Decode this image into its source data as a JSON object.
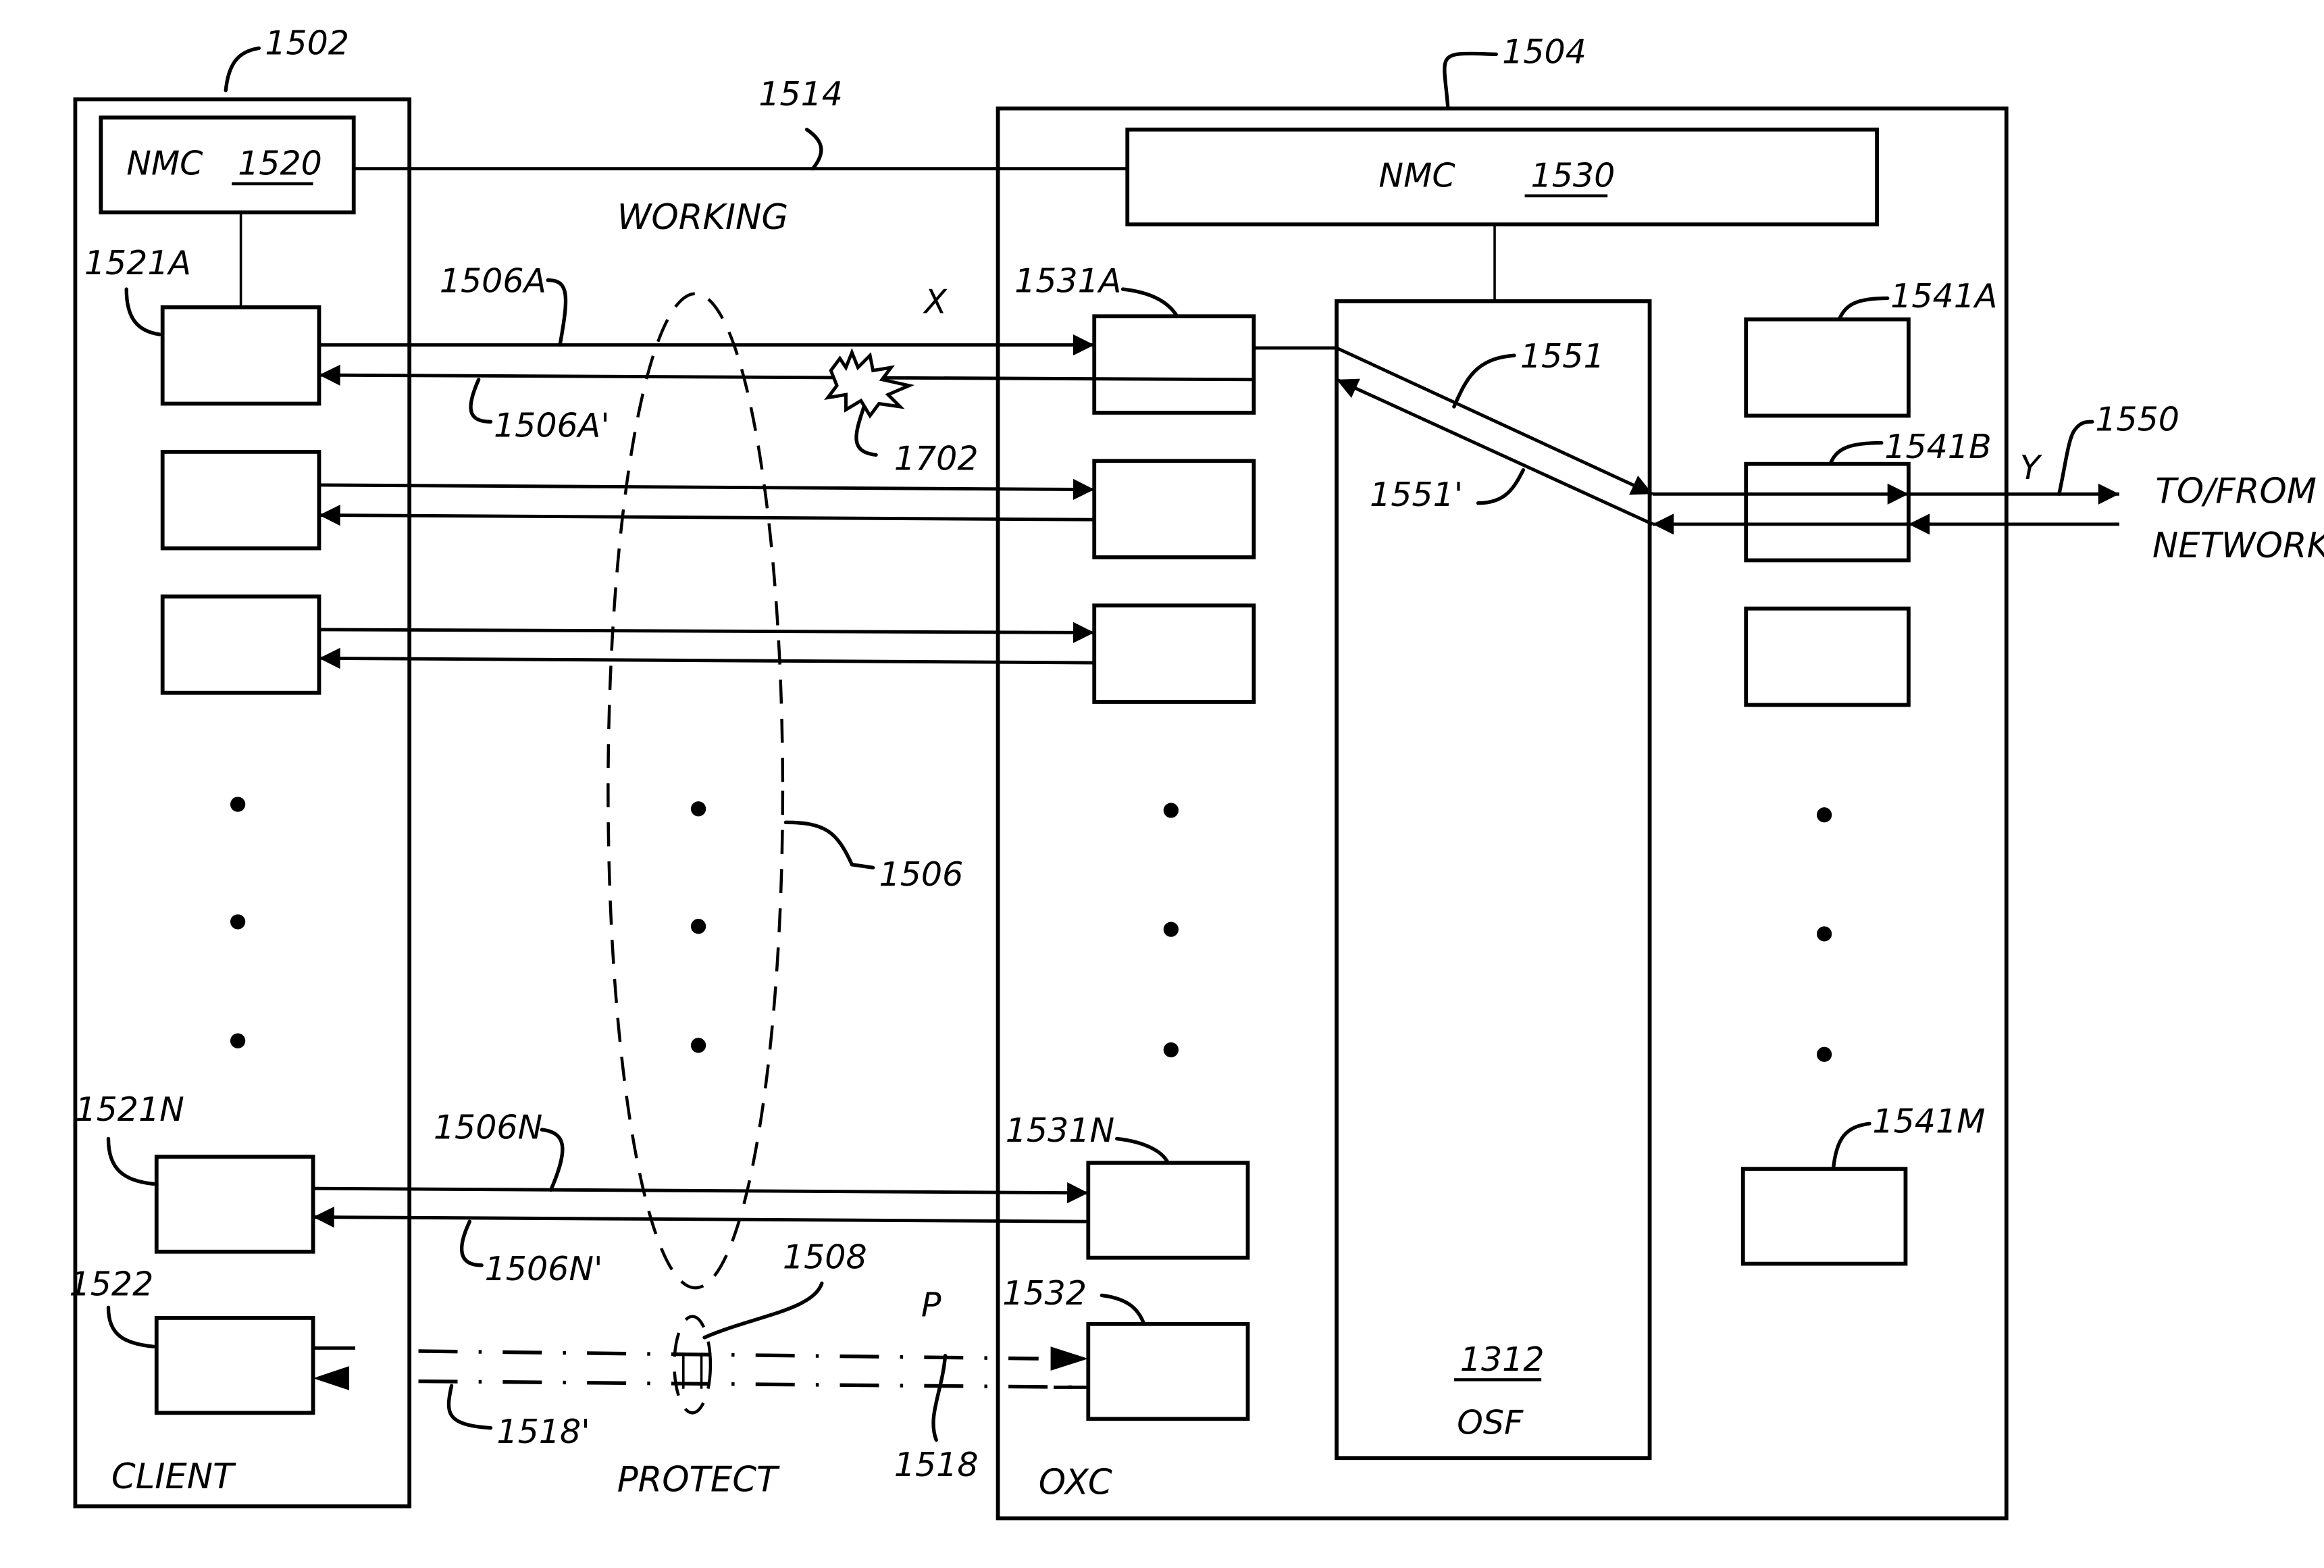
{
  "figure": {
    "client": {
      "ref": "1502",
      "name": "CLIENT",
      "nmc": {
        "label": "NMC",
        "ref": "1520"
      },
      "ports": {
        "first": "1521A",
        "last": "1521N",
        "protect": "1522"
      }
    },
    "oxc": {
      "ref": "1504",
      "name": "OXC",
      "nmc": {
        "label": "NMC",
        "ref": "1530"
      },
      "ports_in": {
        "first": "1531A",
        "last": "1531N",
        "protect": "1532"
      },
      "ports_out": {
        "first": "1541A",
        "second": "1541B",
        "last": "1541M"
      },
      "osf": {
        "ref": "1312",
        "label": "OSF"
      },
      "paths": {
        "forward": "1551",
        "reverse": "1551'"
      }
    },
    "links": {
      "mgmt": "1514",
      "working_label": "WORKING",
      "working_group": "1506",
      "fwd_a": "1506A",
      "rev_a": "1506A'",
      "fwd_n": "1506N",
      "rev_n": "1506N'",
      "protect_label": "PROTECT",
      "protect_group": "1508",
      "protect_fwd": "1518",
      "protect_rev": "1518'",
      "fault": "1702",
      "point_x": "X",
      "point_y": "Y",
      "point_p": "P",
      "network_ref": "1550",
      "network_line1": "TO/FROM",
      "network_line2": "NETWORK"
    }
  }
}
